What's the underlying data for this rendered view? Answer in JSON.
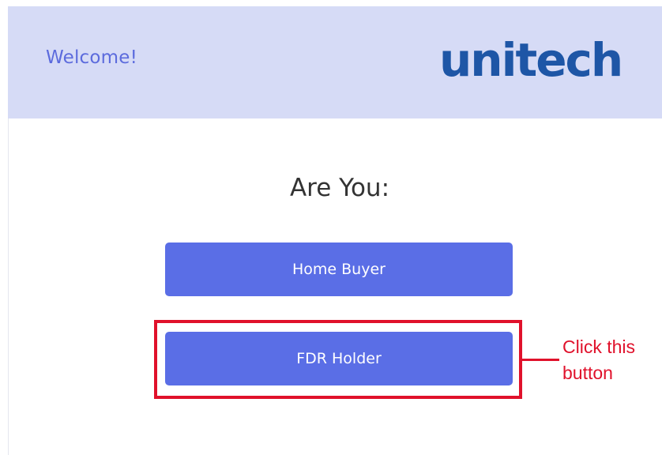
{
  "header": {
    "welcome_text": "Welcome!",
    "logo_text": "unitech"
  },
  "main": {
    "prompt": "Are You:",
    "options": [
      {
        "label": "Home Buyer"
      },
      {
        "label": "FDR Holder"
      }
    ]
  },
  "annotation": {
    "callout_text": "Click this\nbutton"
  },
  "colors": {
    "header_bg": "#d6dbf6",
    "welcome_text": "#5c6bdd",
    "logo": "#1e56a6",
    "button_bg": "#5a6ee6",
    "annotation_red": "#e0112b"
  }
}
